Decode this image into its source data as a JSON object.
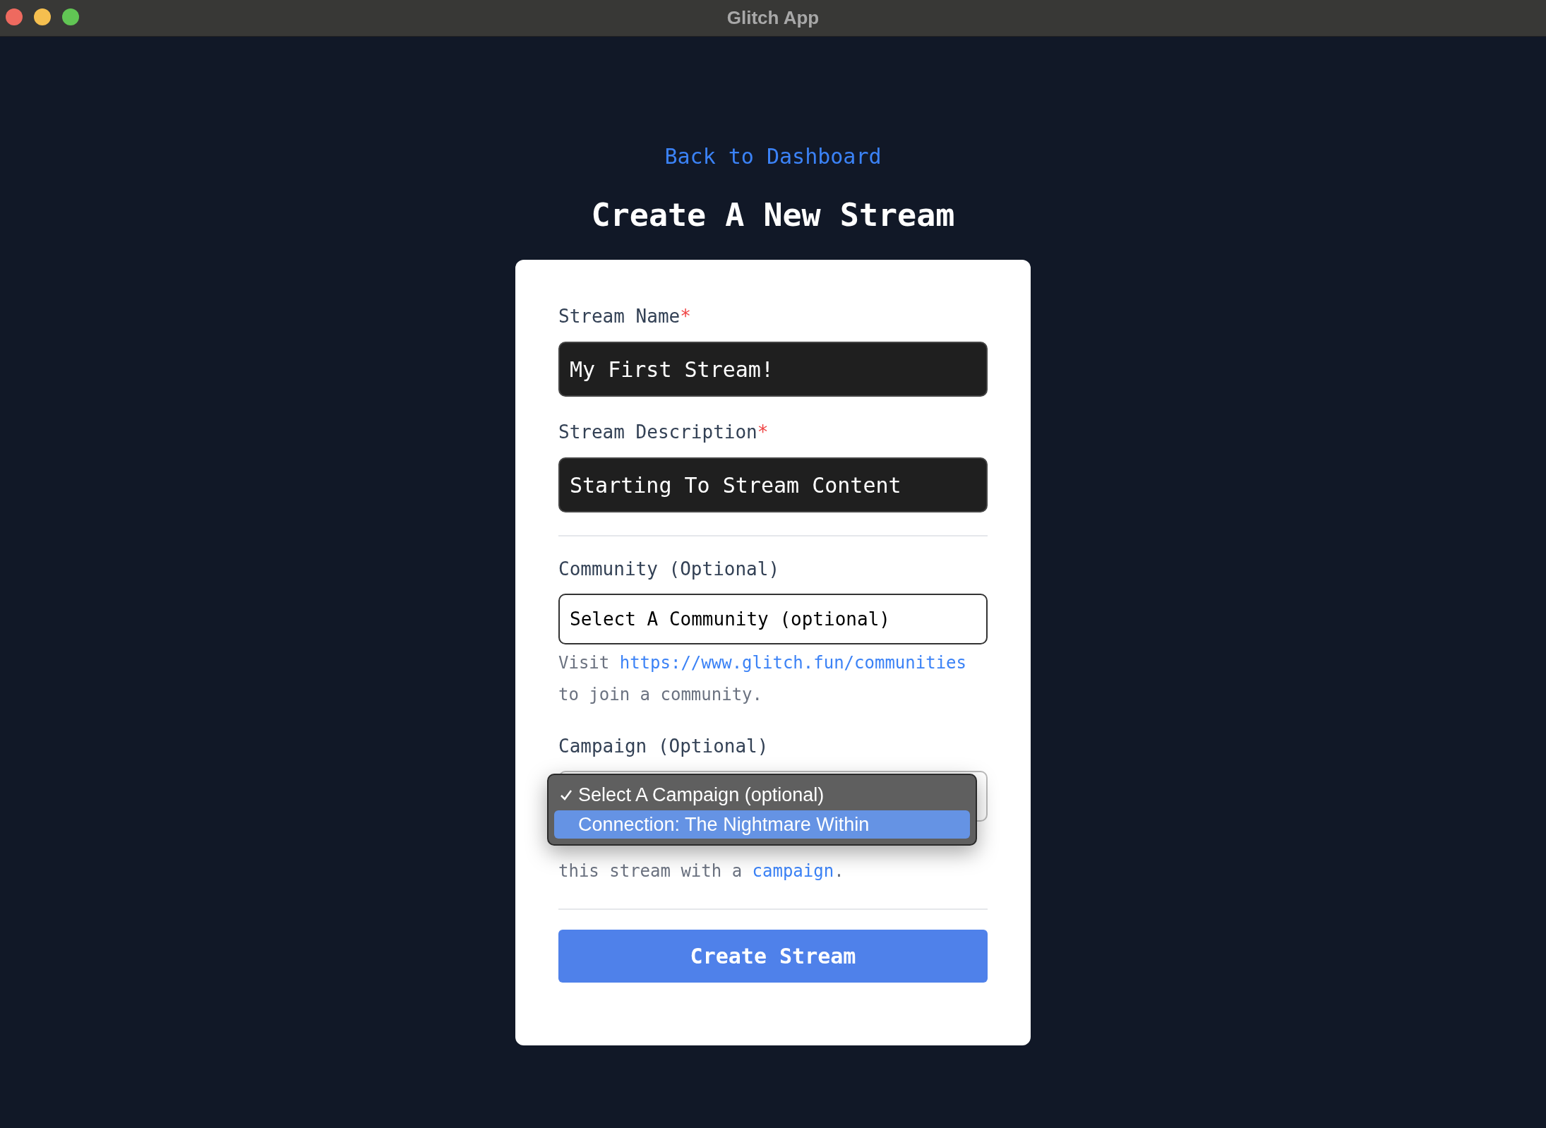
{
  "window": {
    "title": "Glitch App"
  },
  "back_link": "Back to Dashboard",
  "heading": "Create A New Stream",
  "fields": [
    {
      "kind": "text",
      "label": "Stream Name",
      "required_mark": "*",
      "value": "My First Stream!"
    },
    {
      "kind": "text",
      "label": "Stream Description",
      "required_mark": "*",
      "value": "Starting To Stream Content"
    },
    {
      "kind": "divider"
    },
    {
      "kind": "select",
      "label": "Community (Optional)",
      "value": "Select A Community (optional)",
      "helper": {
        "before": "Visit ",
        "link": "https://www.glitch.fun/communities",
        "after": " to join a community."
      }
    },
    {
      "kind": "select_open",
      "label": "Campaign (Optional)",
      "options": [
        {
          "label": "Select A Campaign (optional)",
          "checked": true,
          "selected": false
        },
        {
          "label": "Connection: The Nightmare Within",
          "checked": false,
          "selected": true
        }
      ],
      "helper": {
        "before": "this stream with a ",
        "link": "campaign",
        "after": "."
      }
    },
    {
      "kind": "divider"
    }
  ],
  "submit": "Create Stream"
}
